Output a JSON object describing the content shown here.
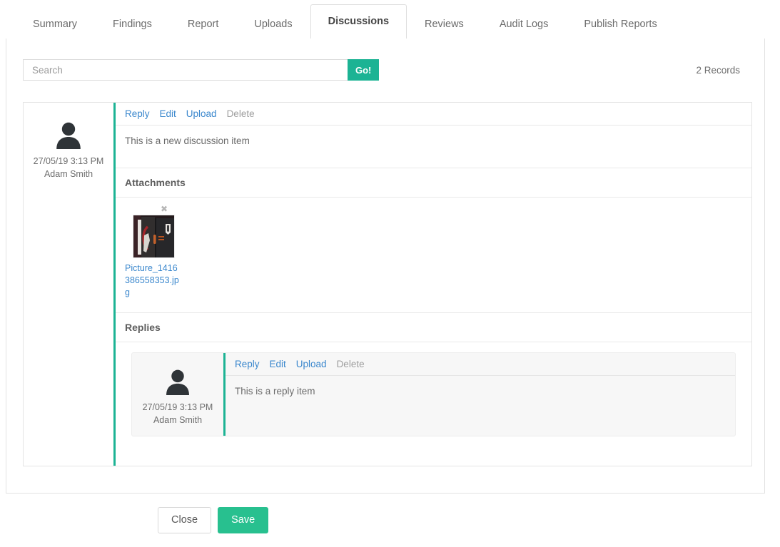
{
  "tabs": [
    {
      "label": "Summary",
      "active": false
    },
    {
      "label": "Findings",
      "active": false
    },
    {
      "label": "Report",
      "active": false
    },
    {
      "label": "Uploads",
      "active": false
    },
    {
      "label": "Discussions",
      "active": true
    },
    {
      "label": "Reviews",
      "active": false
    },
    {
      "label": "Audit Logs",
      "active": false
    },
    {
      "label": "Publish Reports",
      "active": false
    }
  ],
  "search": {
    "placeholder": "Search",
    "value": "",
    "go_label": "Go!"
  },
  "records_label": "2 Records",
  "colors": {
    "accent_green": "#1cb394",
    "save_green": "#28c08f",
    "link_blue": "#3a87cd",
    "disabled_gray": "#9e9e9e"
  },
  "discussion": {
    "author": "Adam Smith",
    "timestamp": "27/05/19 3:13 PM",
    "avatar_icon": "user-avatar-icon",
    "actions": [
      {
        "label": "Reply",
        "enabled": true
      },
      {
        "label": "Edit",
        "enabled": true
      },
      {
        "label": "Upload",
        "enabled": true
      },
      {
        "label": "Delete",
        "enabled": false
      }
    ],
    "message": "This is a new discussion item",
    "attachments_heading": "Attachments",
    "attachments": [
      {
        "filename": "Picture_1416386558353.jpg",
        "remove_icon": "close-icon",
        "thumbnail_alt": "dark cabinet photo thumbnail"
      }
    ],
    "replies_heading": "Replies",
    "replies": [
      {
        "author": "Adam Smith",
        "timestamp": "27/05/19 3:13 PM",
        "avatar_icon": "user-avatar-icon",
        "actions": [
          {
            "label": "Reply",
            "enabled": true
          },
          {
            "label": "Edit",
            "enabled": true
          },
          {
            "label": "Upload",
            "enabled": true
          },
          {
            "label": "Delete",
            "enabled": false
          }
        ],
        "message": "This is a reply item"
      }
    ]
  },
  "footer": {
    "close_label": "Close",
    "save_label": "Save"
  }
}
